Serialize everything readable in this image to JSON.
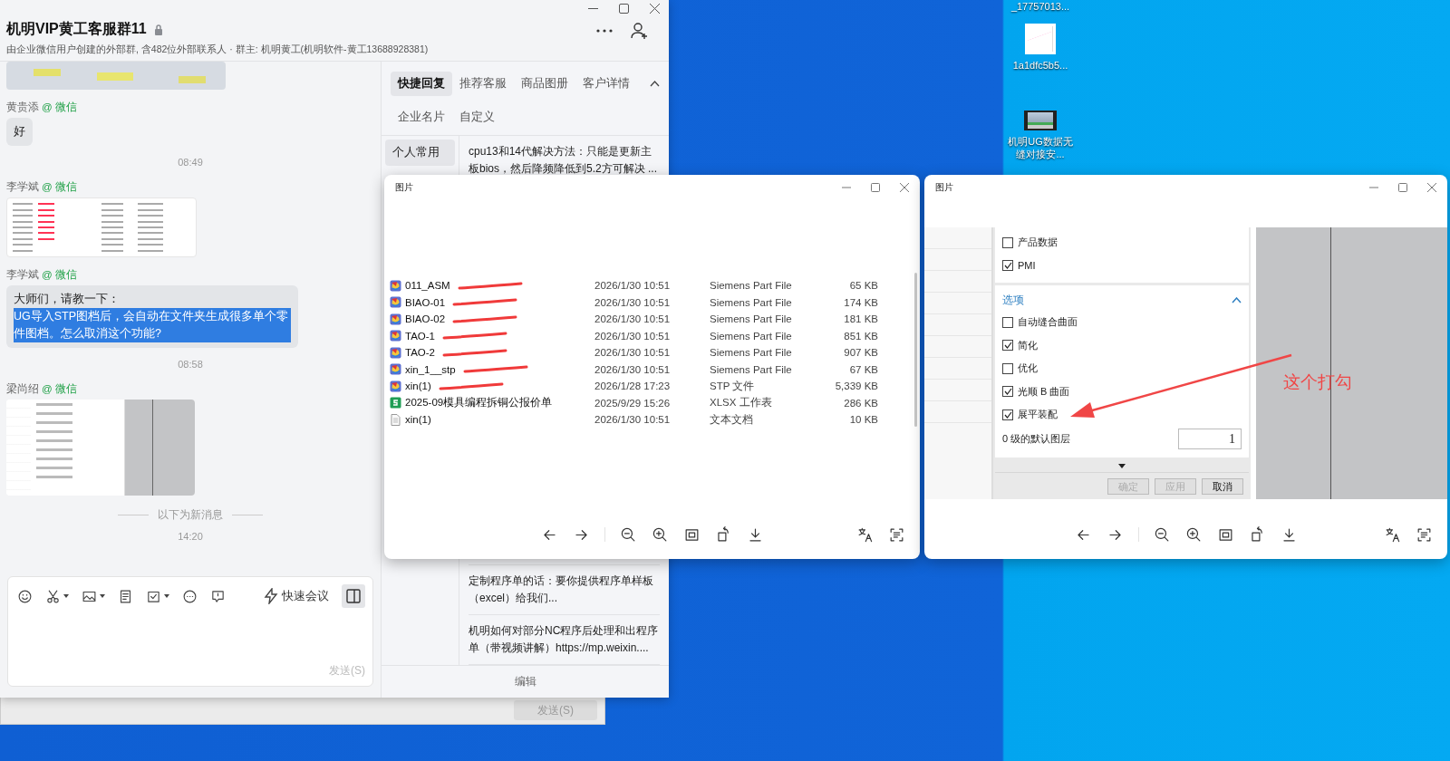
{
  "desktop_icons": [
    {
      "label": "_17757013...",
      "kind": "none"
    },
    {
      "label": "1a1dfc5b5...",
      "kind": "image"
    },
    {
      "label": "机明UG数据无缝对接安...",
      "kind": "video"
    }
  ],
  "background_window": {
    "send_button": "发送(S)"
  },
  "chat_window": {
    "title": "机明VIP黄工客服群11",
    "subtitle": "由企业微信用户创建的外部群, 含482位外部联系人 · 群主: 机明黄工(机明软件-黄工13688928381)",
    "messages": [
      {
        "kind": "photo"
      },
      {
        "kind": "message",
        "sender": "黄贵添",
        "via": "@ 微信",
        "text": "好"
      },
      {
        "kind": "time",
        "text": "08:49"
      },
      {
        "kind": "file_list_shot",
        "sender": "李学斌",
        "via": "@ 微信"
      },
      {
        "kind": "message",
        "sender": "李学斌",
        "via": "@ 微信",
        "text": "大师们，请教一下：",
        "selected_text": "UG导入STP图档后，会自动在文件夹生成很多单个零件图档。怎么取消这个功能?"
      },
      {
        "kind": "time",
        "text": "08:58"
      },
      {
        "kind": "dialog_shot",
        "sender": "梁尚绍",
        "via": "@ 微信"
      },
      {
        "kind": "divider",
        "text": "以下为新消息"
      },
      {
        "kind": "time",
        "text": "14:20"
      }
    ],
    "composer": {
      "meeting_label": "快速会议",
      "send_label": "发送(S)"
    },
    "side_panel": {
      "tabs": [
        {
          "label": "快捷回复",
          "selected": true
        },
        {
          "label": "推荐客服",
          "selected": false
        },
        {
          "label": "商品图册",
          "selected": false
        },
        {
          "label": "客户详情",
          "selected": false
        }
      ],
      "tabs_row2": [
        {
          "label": "企业名片",
          "selected": false
        },
        {
          "label": "自定义",
          "selected": false
        }
      ],
      "categories": [
        {
          "label": "个人常用",
          "selected": true
        }
      ],
      "replies": [
        "cpu13和14代解决方法：只能是更新主板bios，然后降频降低到5.2方可解决 ...",
        "定制程序单的话：要你提供程序单样板（excel）给我们...",
        "机明如何对部分NC程序后处理和出程序单（带视频讲解）https://mp.weixin...."
      ],
      "edit_label": "编辑"
    }
  },
  "file_viewer": {
    "title": "图片",
    "files": [
      {
        "kind": "part",
        "name": "011_ASM",
        "date": "2026/1/30 10:51",
        "type": "Siemens Part File",
        "size": "65 KB",
        "redacted": true
      },
      {
        "kind": "part",
        "name": "BIAO-01",
        "date": "2026/1/30 10:51",
        "type": "Siemens Part File",
        "size": "174 KB",
        "redacted": true
      },
      {
        "kind": "part",
        "name": "BIAO-02",
        "date": "2026/1/30 10:51",
        "type": "Siemens Part File",
        "size": "181 KB",
        "redacted": true
      },
      {
        "kind": "part",
        "name": "TAO-1",
        "date": "2026/1/30 10:51",
        "type": "Siemens Part File",
        "size": "851 KB",
        "redacted": true
      },
      {
        "kind": "part",
        "name": "TAO-2",
        "date": "2026/1/30 10:51",
        "type": "Siemens Part File",
        "size": "907 KB",
        "redacted": true
      },
      {
        "kind": "part",
        "name": "xin_1__stp",
        "date": "2026/1/30 10:51",
        "type": "Siemens Part File",
        "size": "67 KB",
        "redacted": true
      },
      {
        "kind": "part",
        "name": "xin(1)",
        "date": "2026/1/28 17:23",
        "type": "STP 文件",
        "size": "5,339 KB",
        "redacted": true
      },
      {
        "kind": "sheet",
        "name": "2025-09模具编程拆铜公报价单",
        "date": "2025/9/29 15:26",
        "type": "XLSX 工作表",
        "size": "286 KB",
        "redacted": false
      },
      {
        "kind": "text",
        "name": "xin(1)",
        "date": "2026/1/30 10:51",
        "type": "文本文档",
        "size": "10 KB",
        "redacted": false
      }
    ]
  },
  "dialog_viewer": {
    "title": "图片",
    "products": [
      {
        "label": "产品数据",
        "checked": false
      },
      {
        "label": "PMI",
        "checked": true
      }
    ],
    "options_section": {
      "title": "选项",
      "expanded": true
    },
    "options": [
      {
        "label": "自动缝合曲面",
        "checked": false
      },
      {
        "label": "简化",
        "checked": true
      },
      {
        "label": "优化",
        "checked": false
      },
      {
        "label": "光顺 B 曲面",
        "checked": true
      },
      {
        "label": "展平装配",
        "checked": true
      }
    ],
    "layer_label": "0 级的默认图层",
    "layer_value": "1",
    "buttons": [
      {
        "label": "确定",
        "disabled": true
      },
      {
        "label": "应用",
        "disabled": true
      },
      {
        "label": "取消",
        "disabled": false
      }
    ],
    "annotation": "这个打勾"
  }
}
